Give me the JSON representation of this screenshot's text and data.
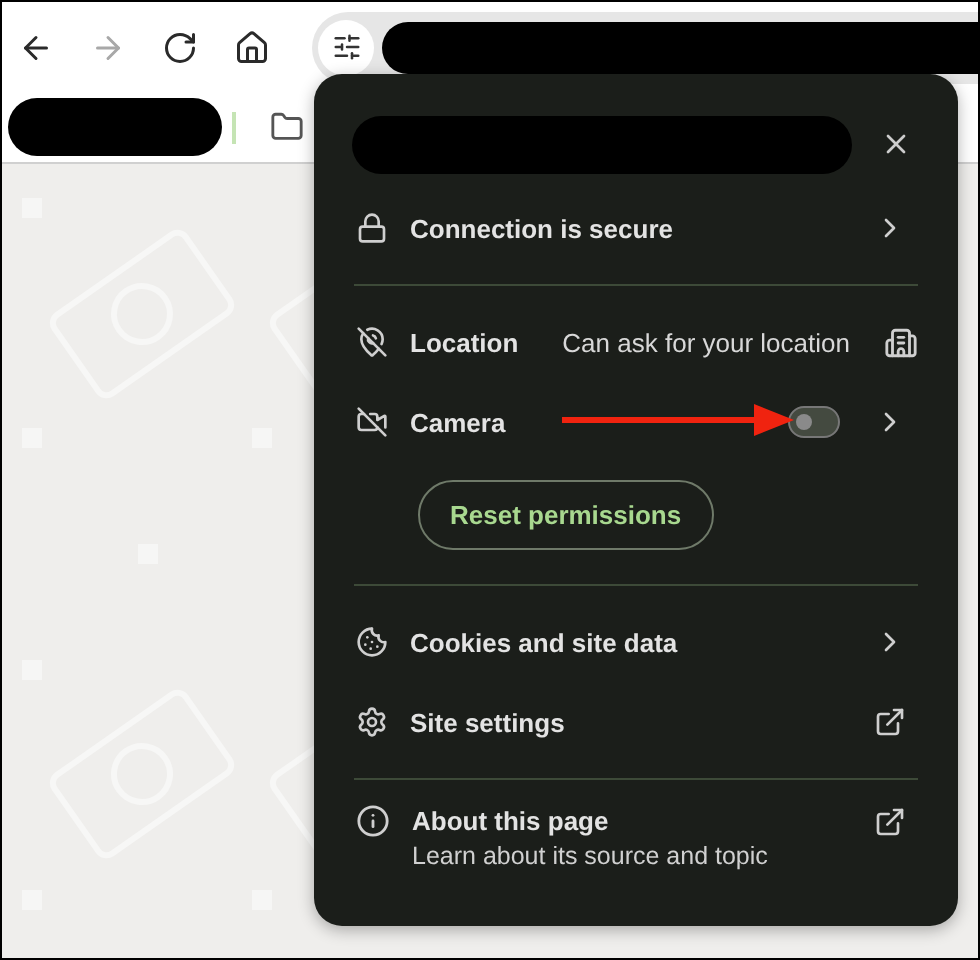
{
  "toolbar": {
    "nav_buttons": [
      {
        "kind": "back",
        "disabled": false
      },
      {
        "kind": "forward",
        "disabled": true
      },
      {
        "kind": "reload",
        "disabled": false
      },
      {
        "kind": "home",
        "disabled": false
      }
    ]
  },
  "site_info": {
    "connection": {
      "label": "Connection is secure"
    },
    "permissions": [
      {
        "kind": "status",
        "label": "Location",
        "status": "Can ask for your location"
      },
      {
        "kind": "toggle",
        "label": "Camera",
        "on": false
      }
    ],
    "reset_button": "Reset permissions",
    "links": [
      {
        "kind": "submenu",
        "label": "Cookies and site data"
      },
      {
        "kind": "external",
        "label": "Site settings"
      }
    ],
    "about": {
      "title": "About this page",
      "subtitle": "Learn about its source and topic"
    }
  }
}
